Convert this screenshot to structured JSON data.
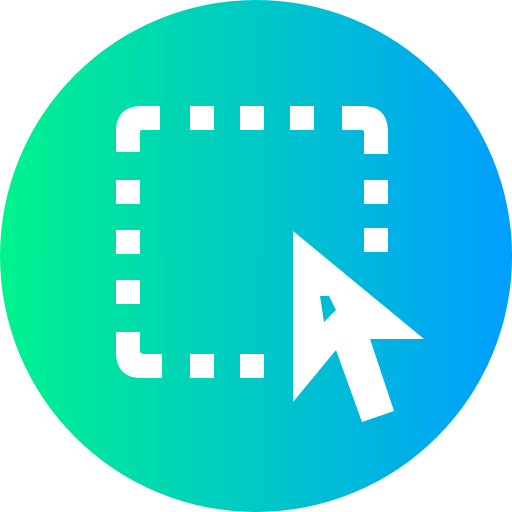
{
  "icon": {
    "name": "select-area-cursor-icon",
    "gradient_start": "#00f38d",
    "gradient_end": "#009eff",
    "foreground": "#ffffff"
  }
}
